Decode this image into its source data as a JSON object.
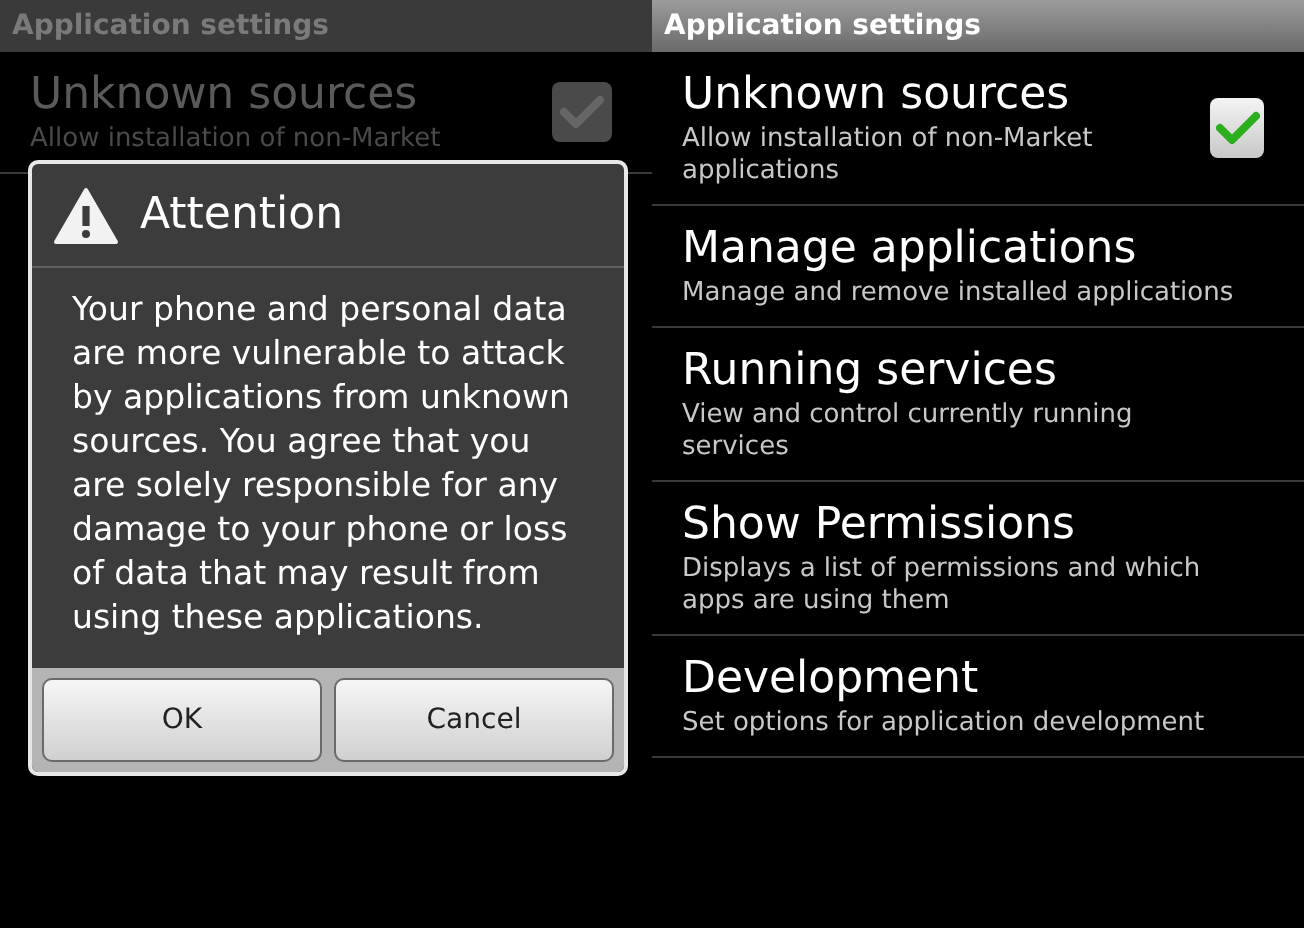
{
  "screens": [
    {
      "title": "Application settings",
      "dimmed": true,
      "settings": [
        {
          "kind": "checkbox",
          "title": "Unknown sources",
          "summary": "Allow installation of non-Market",
          "checked": true
        }
      ],
      "dialog": {
        "title": "Attention",
        "message": "Your phone and personal data are more vulnerable to attack by applications from unknown sources. You agree that you are solely responsible for any damage to your phone or loss of data that may result from using these applications.",
        "buttons": [
          "OK",
          "Cancel"
        ]
      }
    },
    {
      "title": "Application settings",
      "dimmed": false,
      "settings": [
        {
          "kind": "checkbox",
          "title": "Unknown sources",
          "summary": "Allow installation of non-Market applications",
          "checked": true
        },
        {
          "kind": "link",
          "title": "Manage applications",
          "summary": "Manage and remove installed applications"
        },
        {
          "kind": "link",
          "title": "Running services",
          "summary": "View and control currently running services"
        },
        {
          "kind": "link",
          "title": "Show Permissions",
          "summary": "Displays a list of permissions and which apps are using them"
        },
        {
          "kind": "link",
          "title": "Development",
          "summary": "Set options for application development"
        }
      ]
    }
  ]
}
